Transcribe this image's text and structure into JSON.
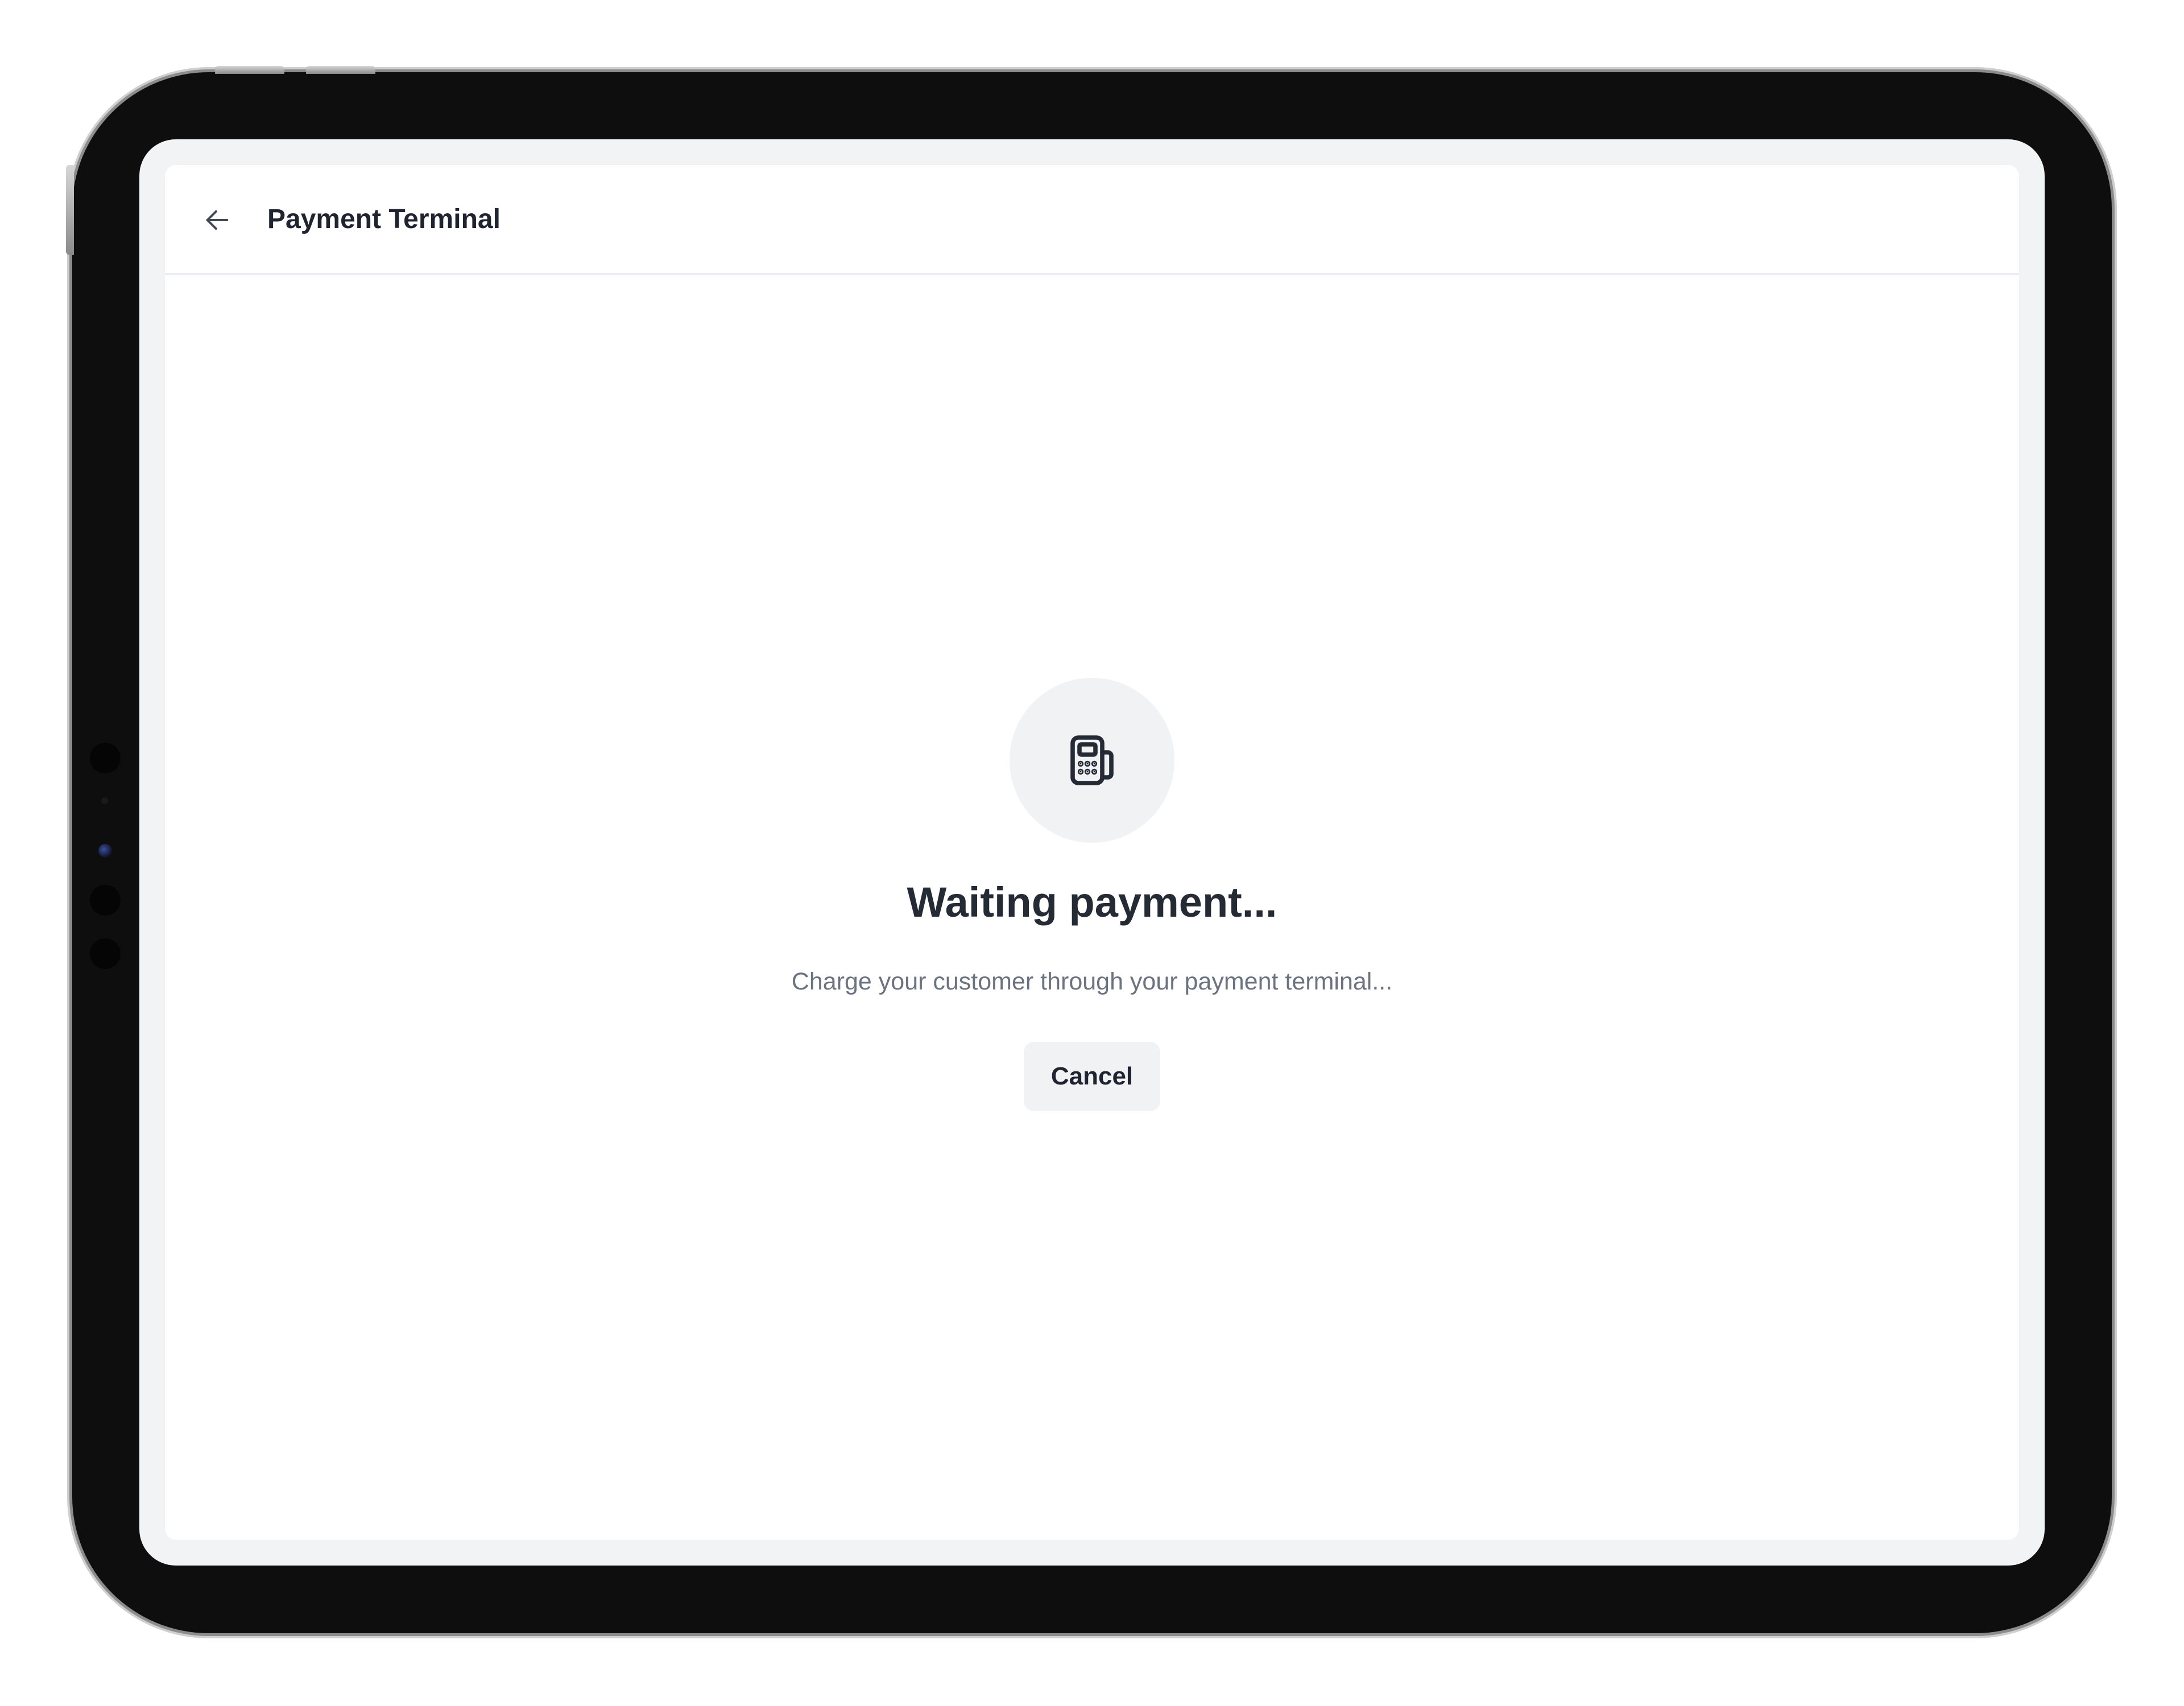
{
  "header": {
    "title": "Payment Terminal",
    "back_icon": "arrow-left-icon"
  },
  "main": {
    "status_icon": "payment-terminal-icon",
    "heading": "Waiting payment...",
    "message": "Charge your customer through your payment terminal...",
    "cancel_label": "Cancel"
  },
  "colors": {
    "title_text": "#1f2430",
    "muted_text": "#6b7280",
    "neutral_surface": "#f1f2f4",
    "bezel": "#0e0e0e"
  }
}
